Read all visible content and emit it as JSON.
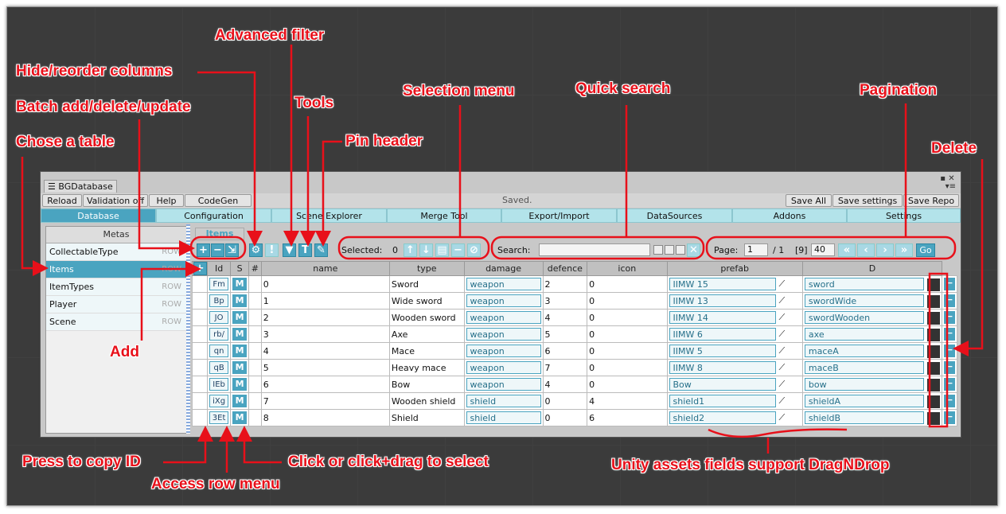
{
  "window": {
    "title": "BGDatabase"
  },
  "toolbar": {
    "reload": "Reload",
    "validation": "Validation off",
    "help": "Help",
    "codegen": "CodeGen",
    "status": "Saved.",
    "save_all": "Save All",
    "save_settings": "Save settings",
    "save_repo": "Save Repo"
  },
  "tabs": [
    "Database",
    "Configuration",
    "Scene Explorer",
    "Merge Tool",
    "Export/Import",
    "DataSources",
    "Addons",
    "Settings"
  ],
  "metas": {
    "header": "Metas",
    "items": [
      {
        "label": "CollectableType",
        "tag": "ROW"
      },
      {
        "label": "Items",
        "tag": "ROW"
      },
      {
        "label": "ItemTypes",
        "tag": "ROW"
      },
      {
        "label": "Player",
        "tag": "ROW"
      },
      {
        "label": "Scene",
        "tag": "ROW"
      }
    ]
  },
  "table_tab": "Items",
  "selection": {
    "label": "Selected:",
    "count": "0"
  },
  "search": {
    "label": "Search:",
    "value": ""
  },
  "pagination": {
    "label": "Page:",
    "page": "1",
    "total": "/ 1",
    "count": "[9]",
    "page_size": "40",
    "go": "Go"
  },
  "columns": [
    "Id",
    "S",
    "#",
    "name",
    "type",
    "damage",
    "defence",
    "icon",
    "prefab",
    "D"
  ],
  "rows": [
    {
      "id": "Fm",
      "num": "0",
      "name": "Sword",
      "type": "weapon",
      "damage": "2",
      "defence": "0",
      "icon": "IIMW 15",
      "prefab": "sword"
    },
    {
      "id": "Bp",
      "num": "1",
      "name": "Wide sword",
      "type": "weapon",
      "damage": "3",
      "defence": "0",
      "icon": "IIMW 13",
      "prefab": "swordWide"
    },
    {
      "id": "JO",
      "num": "2",
      "name": "Wooden sword",
      "type": "weapon",
      "damage": "4",
      "defence": "0",
      "icon": "IIMW 14",
      "prefab": "swordWooden"
    },
    {
      "id": "rb/",
      "num": "3",
      "name": "Axe",
      "type": "weapon",
      "damage": "5",
      "defence": "0",
      "icon": "IIMW 6",
      "prefab": "axe"
    },
    {
      "id": "qn",
      "num": "4",
      "name": "Mace",
      "type": "weapon",
      "damage": "6",
      "defence": "0",
      "icon": "IIMW 5",
      "prefab": "maceA"
    },
    {
      "id": "qB",
      "num": "5",
      "name": "Heavy mace",
      "type": "weapon",
      "damage": "7",
      "defence": "0",
      "icon": "IIMW 8",
      "prefab": "maceB"
    },
    {
      "id": "IEb",
      "num": "6",
      "name": "Bow",
      "type": "weapon",
      "damage": "4",
      "defence": "0",
      "icon": "Bow",
      "prefab": "bow"
    },
    {
      "id": "iXg",
      "num": "7",
      "name": "Wooden shield",
      "type": "shield",
      "damage": "0",
      "defence": "4",
      "icon": "shield1",
      "prefab": "shieldA"
    },
    {
      "id": "3Et",
      "num": "8",
      "name": "Shield",
      "type": "shield",
      "damage": "0",
      "defence": "6",
      "icon": "shield2",
      "prefab": "shieldB"
    }
  ],
  "row_menu": "M",
  "annotations": {
    "advanced_filter": "Advanced filter",
    "hide_reorder": "Hide/reorder columns",
    "batch": "Batch add/delete/update",
    "choose_table": "Chose a table",
    "tools": "Tools",
    "pin_header": "Pin header",
    "selection_menu": "Selection menu",
    "quick_search": "Quick search",
    "pagination": "Pagination",
    "delete": "Delete",
    "add": "Add",
    "copy_id": "Press to copy ID",
    "row_menu": "Access row menu",
    "select": "Click or click+drag to select",
    "dragndrop": "Unity assets fields support DragNDrop"
  }
}
